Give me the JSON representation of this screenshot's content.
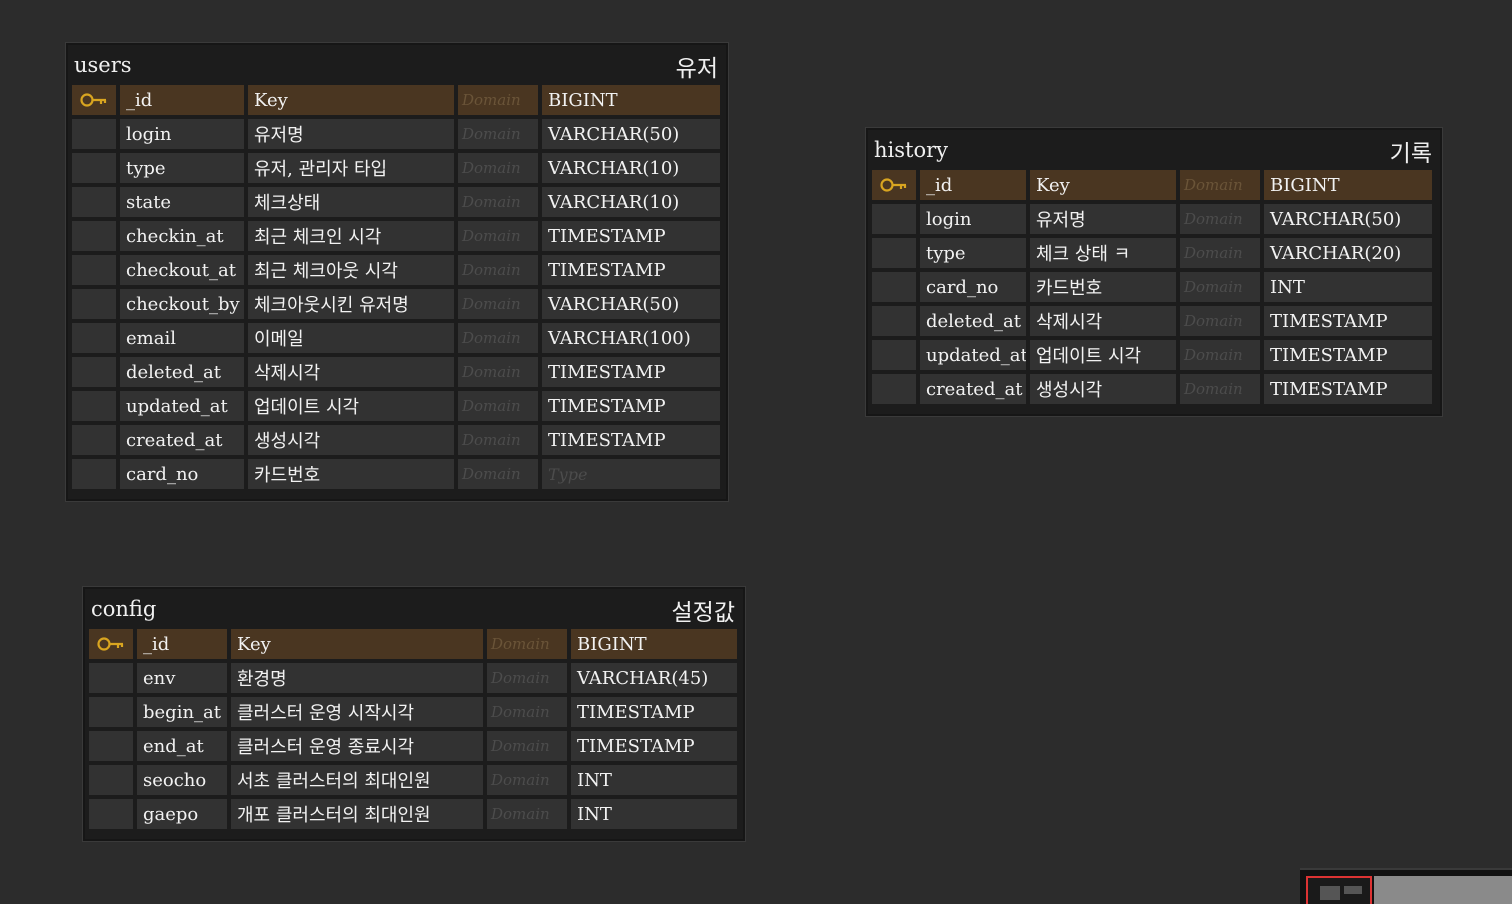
{
  "accent": {
    "pk_row": "#4a3621",
    "key_icon": "#d9a520",
    "minimap_view": "#dd3333"
  },
  "tables": {
    "users": {
      "name": "users",
      "comment": "유저",
      "columns": [
        {
          "pk": true,
          "name": "_id",
          "comment": "Key",
          "domain": "Domain",
          "type": "BIGINT"
        },
        {
          "name": "login",
          "comment": "유저명",
          "domain": "Domain",
          "type": "VARCHAR(50)"
        },
        {
          "name": "type",
          "comment": "유저, 관리자 타입",
          "domain": "Domain",
          "type": "VARCHAR(10)"
        },
        {
          "name": "state",
          "comment": "체크상태",
          "domain": "Domain",
          "type": "VARCHAR(10)"
        },
        {
          "name": "checkin_at",
          "comment": "최근 체크인 시각",
          "domain": "Domain",
          "type": "TIMESTAMP"
        },
        {
          "name": "checkout_at",
          "comment": "최근 체크아웃 시각",
          "domain": "Domain",
          "type": "TIMESTAMP"
        },
        {
          "name": "checkout_by",
          "comment": "체크아웃시킨 유저명",
          "domain": "Domain",
          "type": "VARCHAR(50)"
        },
        {
          "name": "email",
          "comment": "이메일",
          "domain": "Domain",
          "type": "VARCHAR(100)"
        },
        {
          "name": "deleted_at",
          "comment": "삭제시각",
          "domain": "Domain",
          "type": "TIMESTAMP"
        },
        {
          "name": "updated_at",
          "comment": "업데이트 시각",
          "domain": "Domain",
          "type": "TIMESTAMP"
        },
        {
          "name": "created_at",
          "comment": "생성시각",
          "domain": "Domain",
          "type": "TIMESTAMP"
        },
        {
          "name": "card_no",
          "comment": "카드번호",
          "domain": "Domain",
          "type": "Type",
          "type_placeholder": true
        }
      ]
    },
    "history": {
      "name": "history",
      "comment": "기록",
      "columns": [
        {
          "pk": true,
          "name": "_id",
          "comment": "Key",
          "domain": "Domain",
          "type": "BIGINT"
        },
        {
          "name": "login",
          "comment": "유저명",
          "domain": "Domain",
          "type": "VARCHAR(50)"
        },
        {
          "name": "type",
          "comment": "체크 상태 ㅋ",
          "domain": "Domain",
          "type": "VARCHAR(20)"
        },
        {
          "name": "card_no",
          "comment": "카드번호",
          "domain": "Domain",
          "type": "INT"
        },
        {
          "name": "deleted_at",
          "comment": "삭제시각",
          "domain": "Domain",
          "type": "TIMESTAMP"
        },
        {
          "name": "updated_at",
          "comment": "업데이트 시각",
          "domain": "Domain",
          "type": "TIMESTAMP"
        },
        {
          "name": "created_at",
          "comment": "생성시각",
          "domain": "Domain",
          "type": "TIMESTAMP"
        }
      ]
    },
    "config": {
      "name": "config",
      "comment": "설정값",
      "columns": [
        {
          "pk": true,
          "name": "_id",
          "comment": "Key",
          "domain": "Domain",
          "type": "BIGINT"
        },
        {
          "name": "env",
          "comment": "환경명",
          "domain": "Domain",
          "type": "VARCHAR(45)"
        },
        {
          "name": "begin_at",
          "comment": "클러스터 운영 시작시각",
          "domain": "Domain",
          "type": "TIMESTAMP"
        },
        {
          "name": "end_at",
          "comment": "클러스터 운영 종료시각",
          "domain": "Domain",
          "type": "TIMESTAMP"
        },
        {
          "name": "seocho",
          "comment": "서초 클러스터의 최대인원",
          "domain": "Domain",
          "type": "INT"
        },
        {
          "name": "gaepo",
          "comment": "개포 클러스터의 최대인원",
          "domain": "Domain",
          "type": "INT"
        }
      ]
    }
  }
}
